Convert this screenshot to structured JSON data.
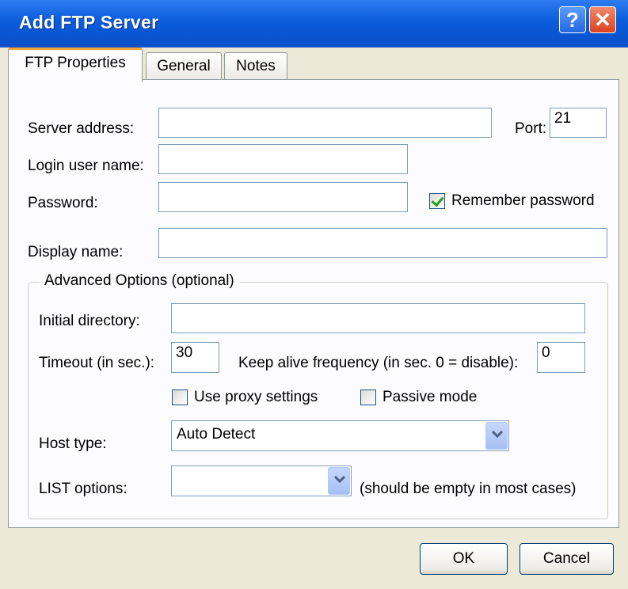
{
  "window": {
    "title": "Add FTP Server",
    "help_glyph": "?",
    "close_glyph": "✕"
  },
  "tabs": [
    "FTP Properties",
    "General",
    "Notes"
  ],
  "form": {
    "server_address_label": "Server address:",
    "server_address_value": "",
    "port_label": "Port:",
    "port_value": "21",
    "login_label": "Login user name:",
    "login_value": "",
    "password_label": "Password:",
    "password_value": "",
    "remember_password_label": "Remember password",
    "remember_password_checked": true,
    "display_name_label": "Display name:",
    "display_name_value": ""
  },
  "advanced": {
    "legend": "Advanced Options  (optional)",
    "initial_dir_label": "Initial directory:",
    "initial_dir_value": "",
    "timeout_label": "Timeout (in sec.):",
    "timeout_value": "30",
    "keepalive_label": "Keep alive frequency (in sec. 0 = disable):",
    "keepalive_value": "0",
    "proxy_label": "Use proxy settings",
    "proxy_checked": false,
    "passive_label": "Passive mode",
    "passive_checked": false,
    "host_type_label": "Host type:",
    "host_type_value": "Auto Detect",
    "list_options_label": "LIST options:",
    "list_options_value": "",
    "list_options_hint": "(should be empty in most cases)"
  },
  "buttons": {
    "ok": "OK",
    "cancel": "Cancel"
  },
  "colors": {
    "titlebar": "#0A5CDC",
    "dialog_bg": "#ECE9D8",
    "tab_accent": "#F3A33A",
    "check": "#21A121"
  }
}
